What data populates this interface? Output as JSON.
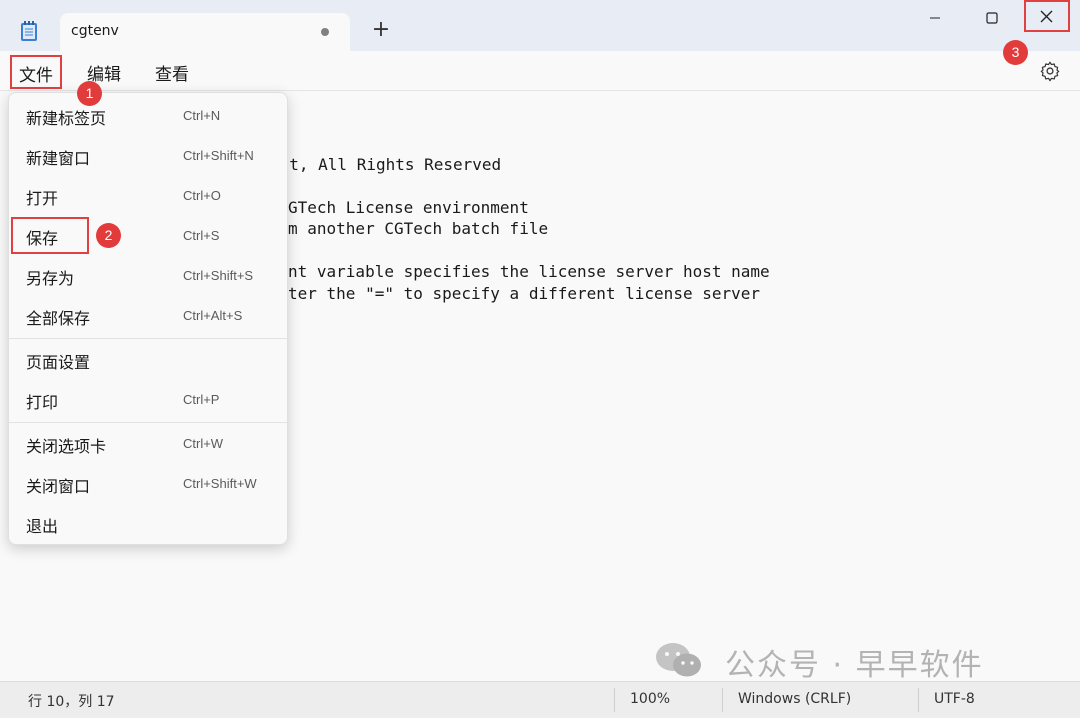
{
  "tab": {
    "title": "cgtenv",
    "new_tab_symbol": "+"
  },
  "menubar": {
    "file": "文件",
    "edit": "编辑",
    "view": "查看"
  },
  "editor": {
    "lines": [
      "ght, All Rights Reserved",
      "GTech License environment",
      "m another CGTech batch file",
      "nt variable specifies the license server host name",
      "ter the \"=\" to specify a different license server"
    ]
  },
  "file_menu": {
    "items": [
      {
        "label": "新建标签页",
        "shortcut": "Ctrl+N"
      },
      {
        "label": "新建窗口",
        "shortcut": "Ctrl+Shift+N"
      },
      {
        "label": "打开",
        "shortcut": "Ctrl+O"
      },
      {
        "label": "保存",
        "shortcut": "Ctrl+S"
      },
      {
        "label": "另存为",
        "shortcut": "Ctrl+Shift+S"
      },
      {
        "label": "全部保存",
        "shortcut": "Ctrl+Alt+S"
      },
      {
        "label": "页面设置",
        "shortcut": ""
      },
      {
        "label": "打印",
        "shortcut": "Ctrl+P"
      },
      {
        "label": "关闭选项卡",
        "shortcut": "Ctrl+W"
      },
      {
        "label": "关闭窗口",
        "shortcut": "Ctrl+Shift+W"
      },
      {
        "label": "退出",
        "shortcut": ""
      }
    ]
  },
  "badges": {
    "one": "1",
    "two": "2",
    "three": "3"
  },
  "watermark": {
    "text": "公众号 · 早早软件"
  },
  "statusbar": {
    "position": "行 10，列 17",
    "zoom": "100%",
    "line_ending": "Windows (CRLF)",
    "encoding": "UTF-8"
  },
  "colors": {
    "highlight_red": "#e04040",
    "badge_red": "#e23b3b"
  },
  "icons": [
    "notepad-app-icon",
    "minimize-icon",
    "maximize-icon",
    "close-icon",
    "gear-icon",
    "wechat-icon"
  ]
}
